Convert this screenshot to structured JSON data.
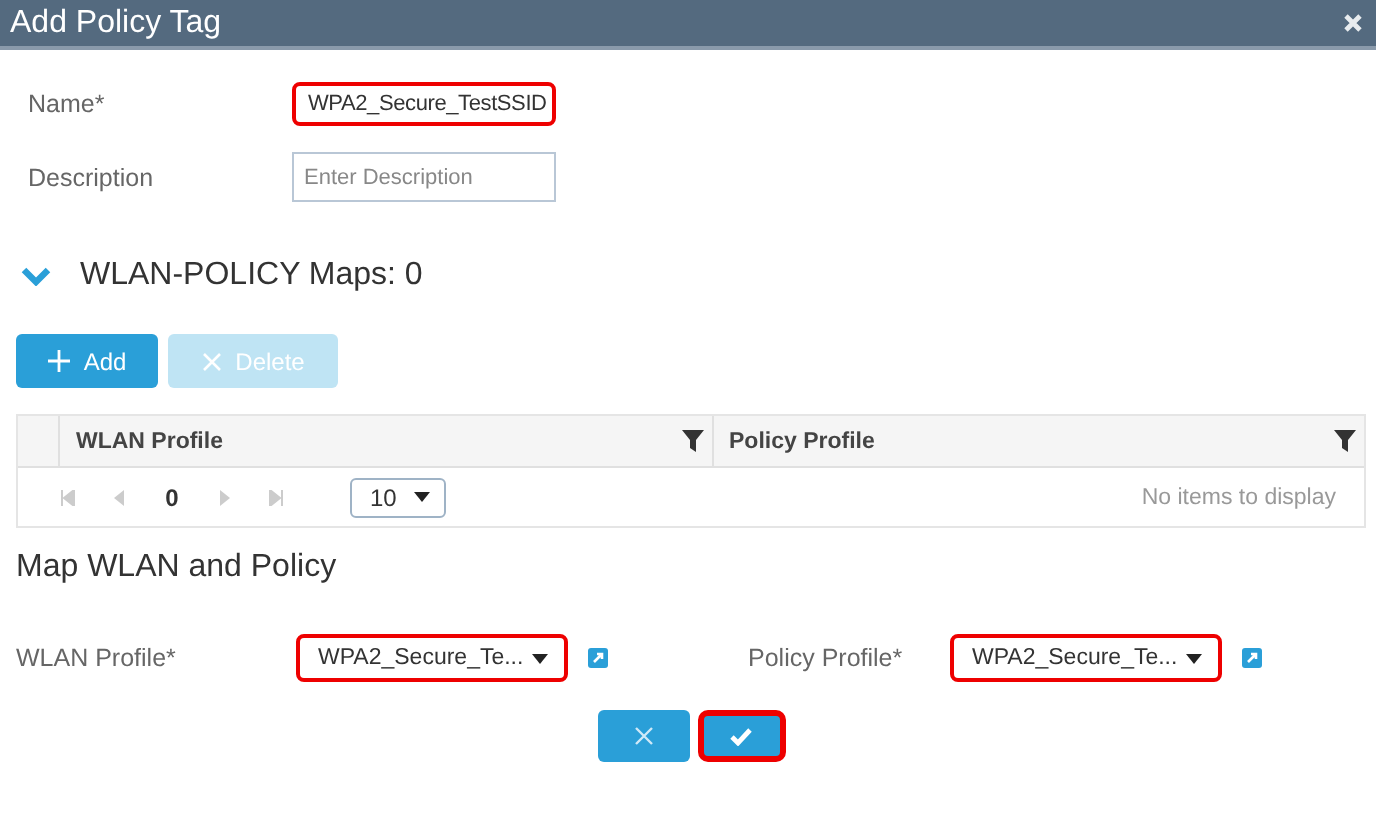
{
  "window": {
    "title": "Add Policy Tag"
  },
  "fields": [
    {
      "label": "Name*",
      "value": "WPA2_Secure_TestSSID",
      "highlighted": true
    },
    {
      "label": "Description",
      "placeholder": "Enter Description",
      "highlighted": false
    }
  ],
  "section": {
    "title": "WLAN-POLICY Maps: 0",
    "expanded": true
  },
  "actions": [
    {
      "label": "Add",
      "kind": "add",
      "disabled": false
    },
    {
      "label": "Delete",
      "kind": "delete",
      "disabled": true
    }
  ],
  "table": {
    "columns": [
      "WLAN Profile",
      "Policy Profile"
    ],
    "page": "0",
    "page_size": "10",
    "empty_text": "No items to display"
  },
  "map": {
    "title": "Map WLAN and Policy",
    "selects": [
      {
        "label": "WLAN Profile*",
        "value": "WPA2_Secure_Te...",
        "highlighted": true
      },
      {
        "label": "Policy Profile*",
        "value": "WPA2_Secure_Te...",
        "highlighted": true
      }
    ]
  },
  "footer": [
    {
      "kind": "cancel",
      "highlighted": false
    },
    {
      "kind": "ok",
      "highlighted": true
    }
  ]
}
